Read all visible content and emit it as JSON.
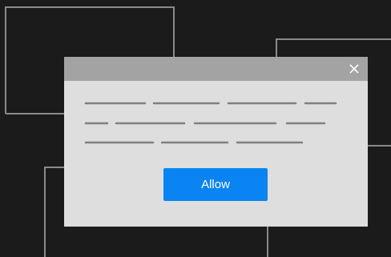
{
  "dialog": {
    "close_icon": "close-icon",
    "allow_label": "Allow"
  },
  "colors": {
    "background": "#1b1b1b",
    "dialog_body": "#dedede",
    "dialog_header": "#a3a3a3",
    "placeholder_line": "#808080",
    "accent": "#0a84f2"
  }
}
